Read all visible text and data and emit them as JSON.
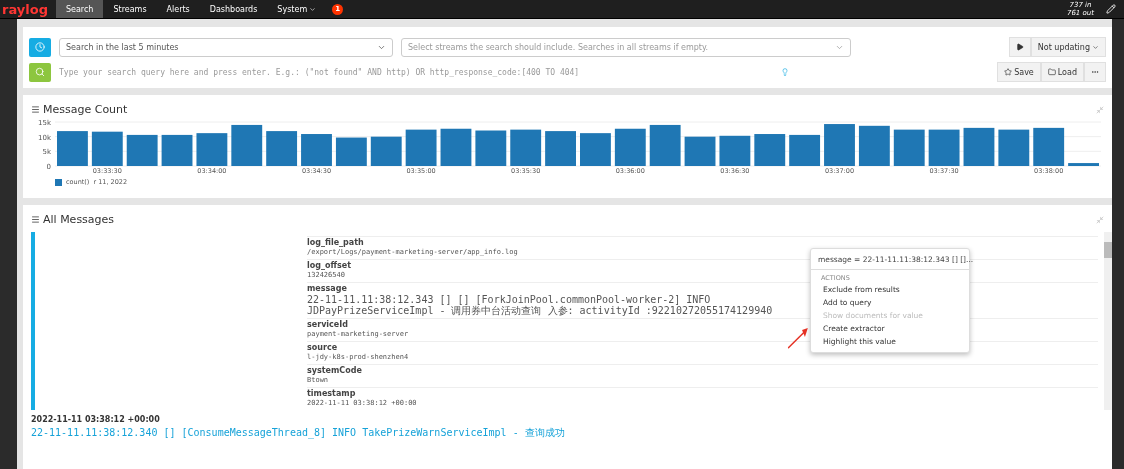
{
  "navbar": {
    "logo": "raylog",
    "tabs": [
      {
        "label": "Search",
        "selected": true,
        "caret": false
      },
      {
        "label": "Streams",
        "selected": false,
        "caret": false
      },
      {
        "label": "Alerts",
        "selected": false,
        "caret": false
      },
      {
        "label": "Dashboards",
        "selected": false,
        "caret": false
      },
      {
        "label": "System",
        "selected": false,
        "caret": true
      }
    ],
    "notification_count": "1",
    "throughput_in": "737 in",
    "throughput_out": "761 out"
  },
  "search": {
    "time_range": "Search in the last 5 minutes",
    "streams_placeholder": "Select streams the search should include. Searches in all streams if empty.",
    "query_placeholder": "Type your search query here and press enter. E.g.: (\"not found\" AND http) OR http_response_code:[400 TO 404]",
    "refresh": "Not updating",
    "save": "Save",
    "load": "Load"
  },
  "message_count": {
    "title": "Message Count",
    "legend": "r 11, 2022",
    "chart_data": {
      "type": "bar",
      "categories": [
        null,
        "03:33:30",
        null,
        null,
        "03:34:00",
        null,
        null,
        "03:34:30",
        null,
        null,
        "03:35:00",
        null,
        null,
        "03:35:30",
        null,
        null,
        "03:36:00",
        null,
        null,
        "03:36:30",
        null,
        null,
        "03:37:00",
        null,
        null,
        "03:37:30",
        null,
        null,
        "03:38:00",
        null
      ],
      "series": [
        {
          "name": "count()",
          "color": "#1f77b4",
          "values": [
            11900,
            11700,
            10600,
            10600,
            11200,
            14000,
            11900,
            10900,
            9700,
            10000,
            12400,
            12700,
            12100,
            12400,
            11900,
            11200,
            12700,
            14000,
            10000,
            10300,
            10900,
            10600,
            14300,
            13700,
            12400,
            12400,
            13000,
            12400,
            13000,
            1000
          ]
        }
      ],
      "yticks": [
        {
          "value": 0,
          "label": "0"
        },
        {
          "value": 5000,
          "label": "5k"
        },
        {
          "value": 10000,
          "label": "10k"
        },
        {
          "value": 15000,
          "label": "15k"
        }
      ],
      "ylim": [
        0,
        15000
      ]
    }
  },
  "all_messages": {
    "title": "All Messages",
    "fields": [
      {
        "name": "log_file_path",
        "value": "/export/Logs/payment-marketing-server/app_info.log"
      },
      {
        "name": "log_offset",
        "value": "132426540"
      },
      {
        "name": "message",
        "value": "22-11-11.11:38:12.343 [] [] [ForkJoinPool.commonPool-worker-2] INFO  JDPayPrizeServiceImpl  - 调用券中台活动查询 入参: activityId :92210272055174129940"
      },
      {
        "name": "serviceId",
        "value": "payment-marketing-server"
      },
      {
        "name": "source",
        "value": "l-jdy-k8s-prod-shenzhen4"
      },
      {
        "name": "systemCode",
        "value": "Btown"
      },
      {
        "name": "timestamp",
        "value": "2022-11-11 03:38:12 +00:00"
      }
    ],
    "next_timestamp": "2022-11-11 03:38:12 +00:00",
    "next_message": "22-11-11.11:38:12.340 [] [ConsumeMessageThread_8] INFO TakePrizeWarnServiceImpl - 查询成功",
    "popover": {
      "title": "message = 22-11-11.11:38:12.343 [] []...",
      "section": "ACTIONS",
      "actions": [
        {
          "label": "Exclude from results",
          "disabled": false
        },
        {
          "label": "Add to query",
          "disabled": false
        },
        {
          "label": "Show documents for value",
          "disabled": true
        },
        {
          "label": "Create extractor",
          "disabled": false
        },
        {
          "label": "Highlight this value",
          "disabled": false
        }
      ]
    }
  }
}
